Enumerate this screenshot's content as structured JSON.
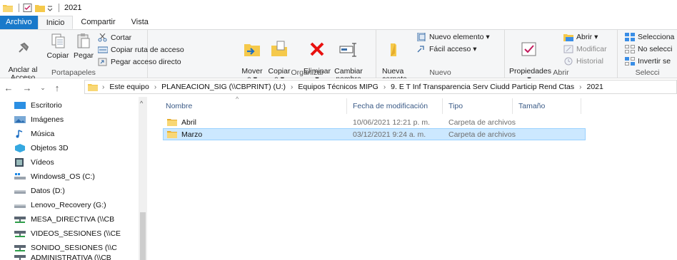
{
  "window": {
    "title": "2021"
  },
  "tabs": [
    "Archivo",
    "Inicio",
    "Compartir",
    "Vista"
  ],
  "ribbon": {
    "portapapeles": {
      "label": "Portapapeles",
      "pin": "Anclar al\nAcceso rápido",
      "copy": "Copiar",
      "paste": "Pegar",
      "cut": "Cortar",
      "copy_path": "Copiar ruta de acceso",
      "paste_shortcut": "Pegar acceso directo"
    },
    "organizar": {
      "label": "Organizar",
      "move": "Mover\na ▾",
      "copy_to": "Copiar\na ▾",
      "delete": "Eliminar\n▾",
      "rename": "Cambiar\nnombre"
    },
    "nuevo": {
      "label": "Nuevo",
      "new_folder": "Nueva\ncarpeta",
      "new_item": "Nuevo elemento ▾",
      "easy_access": "Fácil acceso ▾"
    },
    "abrir": {
      "label": "Abrir",
      "properties": "Propiedades\n▾",
      "open": "Abrir ▾",
      "edit": "Modificar",
      "history": "Historial"
    },
    "seleccionar": {
      "label": "Selecci",
      "select_all": "Selecciona",
      "select_none": "No selecci",
      "invert": "Invertir se"
    }
  },
  "address": {
    "crumbs": [
      "Este equipo",
      "PLANEACION_SIG (\\\\CBPRINT) (U:)",
      "Equipos Técnicos MIPG",
      "9. E T Inf Transparencia Serv Ciudd Particip Rend Ctas",
      "2021"
    ]
  },
  "nav_pane": {
    "items": [
      {
        "label": "Escritorio",
        "icon": "desktop-icon"
      },
      {
        "label": "Imágenes",
        "icon": "pictures-icon"
      },
      {
        "label": "Música",
        "icon": "music-icon"
      },
      {
        "label": "Objetos 3D",
        "icon": "objects3d-icon"
      },
      {
        "label": "Vídeos",
        "icon": "videos-icon"
      },
      {
        "label": "Windows8_OS (C:)",
        "icon": "os-drive-icon"
      },
      {
        "label": "Datos (D:)",
        "icon": "drive-icon"
      },
      {
        "label": "Lenovo_Recovery (G:)",
        "icon": "drive-icon"
      },
      {
        "label": "MESA_DIRECTIVA (\\\\CB",
        "icon": "network-drive-icon"
      },
      {
        "label": "VIDEOS_SESIONES (\\\\CE",
        "icon": "network-drive-icon"
      },
      {
        "label": "SONIDO_SESIONES (\\\\C",
        "icon": "network-drive-icon"
      },
      {
        "label": "ADMINISTRATIVA (\\\\CB",
        "icon": "network-drive-icon"
      }
    ]
  },
  "file_list": {
    "columns": [
      "Nombre",
      "Fecha de modificación",
      "Tipo",
      "Tamaño"
    ],
    "rows": [
      {
        "name": "Abril",
        "date": "10/06/2021 12:21 p. m.",
        "type": "Carpeta de archivos",
        "size": ""
      },
      {
        "name": "Marzo",
        "date": "03/12/2021 9:24 a. m.",
        "type": "Carpeta de archivos",
        "size": ""
      }
    ]
  },
  "colors": {
    "accent": "#1979ca",
    "selection": "#cce8ff",
    "folder": "#f5c94b"
  }
}
